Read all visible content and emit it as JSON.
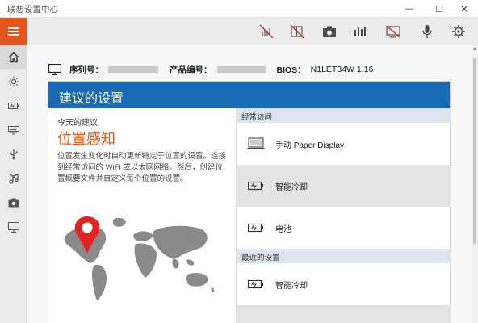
{
  "window": {
    "title": "联想设置中心",
    "minimize": "—",
    "maximize": "☐",
    "close": "✕"
  },
  "sidebar": {
    "menu_icon": "hamburger-icon",
    "items": [
      {
        "name": "home",
        "icon": "home-icon"
      },
      {
        "name": "display",
        "icon": "brightness-icon"
      },
      {
        "name": "power",
        "icon": "battery-icon"
      },
      {
        "name": "input",
        "icon": "keyboard-icon"
      },
      {
        "name": "connectivity",
        "icon": "usb-icon"
      },
      {
        "name": "audio",
        "icon": "music-icon"
      },
      {
        "name": "camera",
        "icon": "camera-icon"
      },
      {
        "name": "monitor",
        "icon": "monitor-icon"
      }
    ]
  },
  "toolbar": {
    "icons": [
      "brightness-off-icon",
      "display-off-icon",
      "camera-icon",
      "equalizer-icon",
      "screen-off-icon",
      "microphone-icon",
      "gear-icon"
    ]
  },
  "device_info": {
    "serial_label": "序列号：",
    "product_label": "产品编号：",
    "bios_label": "BIOS：",
    "bios_value": "N1LET34W 1.16"
  },
  "recommend": {
    "header": "建议的设置",
    "today_label": "今天的建议",
    "feature_title": "位置感知",
    "description": "位置发生变化时自动更新特定于位置的设置。连接到经常访问的 WiFi 或以太网网络。然后，创建位置概要文件并自定义每个位置的设置。"
  },
  "frequent": {
    "header": "经常访问",
    "items": [
      {
        "label": "手动 Paper Display",
        "icon": "paper-display-icon"
      },
      {
        "label": "智能冷却",
        "icon": "battery-icon"
      },
      {
        "label": "电池",
        "icon": "battery-icon"
      }
    ]
  },
  "recent": {
    "header": "最近的设置",
    "items": [
      {
        "label": "智能冷却",
        "icon": "battery-icon"
      }
    ]
  },
  "colors": {
    "accent": "#e5561c",
    "header_blue": "#1a6ab5",
    "map_gray": "#8a8a8a",
    "pin_red": "#e02424"
  }
}
